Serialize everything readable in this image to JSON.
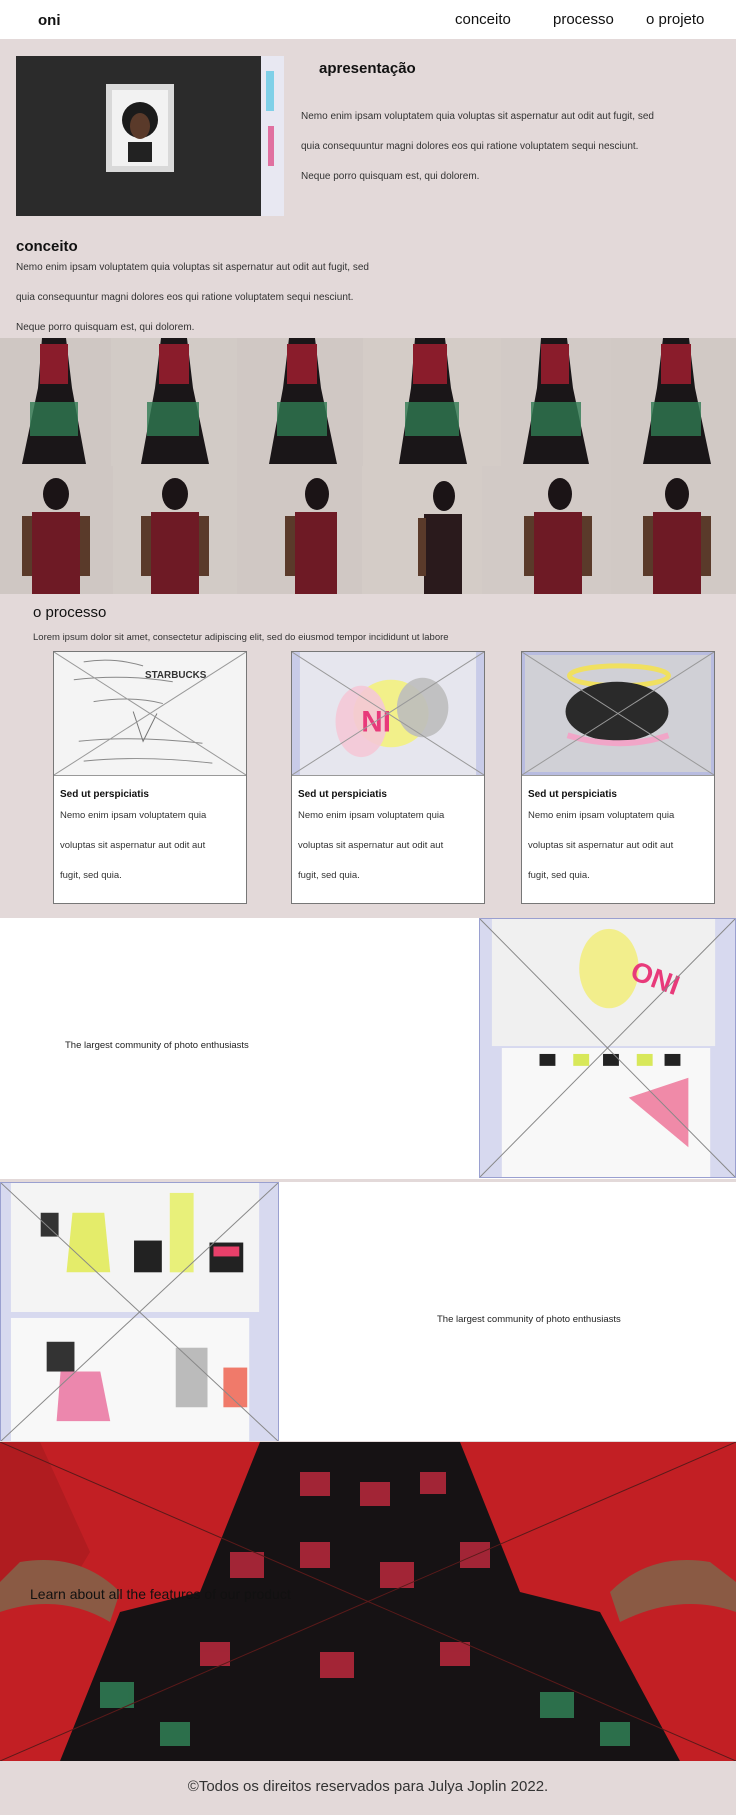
{
  "nav": {
    "brand": "oni",
    "links": [
      "conceito",
      "processo",
      "o projeto"
    ]
  },
  "apresentacao": {
    "title": "apresentação",
    "lines": [
      "Nemo enim ipsam voluptatem quia voluptas sit aspernatur aut odit aut fugit, sed",
      "quia consequuntur magni dolores eos qui ratione voluptatem sequi nesciunt.",
      "Neque porro quisquam est, qui dolorem."
    ]
  },
  "conceito": {
    "title": "conceito",
    "lines": [
      "Nemo enim ipsam voluptatem quia voluptas sit aspernatur aut odit aut fugit, sed",
      "quia consequuntur magni dolores eos qui ratione voluptatem sequi nesciunt.",
      "Neque porro quisquam est, qui dolorem."
    ]
  },
  "processo": {
    "title": "o processo",
    "subtitle": "Lorem ipsum dolor sit amet, consectetur adipiscing elit, sed do eiusmod tempor incididunt ut labore",
    "cards": [
      {
        "title": "Sed ut perspiciatis",
        "lines": [
          "Nemo enim ipsam voluptatem quia",
          "voluptas sit aspernatur aut odit aut",
          "fugit, sed quia."
        ],
        "img_label": "STARBUCKS"
      },
      {
        "title": "Sed ut perspiciatis",
        "lines": [
          "Nemo enim ipsam voluptatem quia",
          "voluptas sit aspernatur aut odit aut",
          "fugit, sed quia."
        ],
        "img_label": "NI"
      },
      {
        "title": "Sed ut perspiciatis",
        "lines": [
          "Nemo enim ipsam voluptatem quia",
          "voluptas sit aspernatur aut odit aut",
          "fugit, sed quia."
        ],
        "img_label": ""
      }
    ]
  },
  "features": [
    {
      "text": "The largest community of photo enthusiasts",
      "img_label": "ONI"
    },
    {
      "text": "The largest community of photo enthusiasts"
    }
  ],
  "hero": {
    "text": "Learn about all the features of our product"
  },
  "footer": {
    "text": "©Todos os direitos reservados para Julya Joplin 2022."
  },
  "colors": {
    "beige": "#e3d9d9",
    "dress_red": "#8a1c2b",
    "dress_green": "#2f7a52",
    "hero_red": "#c21f24"
  }
}
